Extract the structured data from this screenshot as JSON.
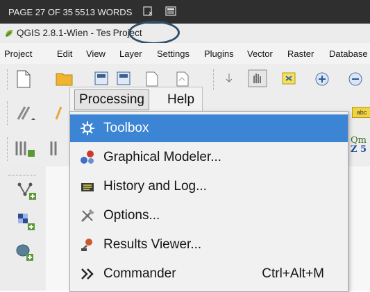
{
  "word_status": {
    "page": "PAGE 27 OF 35",
    "words": "5513 WORDS"
  },
  "window": {
    "title_prefix": "QGIS 2.8.1-Wien - Tes",
    "title_suffix": "Project"
  },
  "menubar": {
    "items": [
      "Project",
      "Edit",
      "View",
      "Layer",
      "Settings",
      "Plugins",
      "Vector",
      "Raster",
      "Database"
    ]
  },
  "toolbar_partial_text": {
    "abc": "abc",
    "qm": "Qm",
    "z5": "Z 5"
  },
  "menu": {
    "processing_label": "Processing",
    "help_label": "Help",
    "items": [
      {
        "label": "Toolbox",
        "shortcut": "",
        "icon": "gear-icon"
      },
      {
        "label": "Graphical Modeler...",
        "shortcut": "",
        "icon": "modeler-icon"
      },
      {
        "label": "History and Log...",
        "shortcut": "",
        "icon": "history-icon"
      },
      {
        "label": "Options...",
        "shortcut": "",
        "icon": "tools-icon"
      },
      {
        "label": "Results Viewer...",
        "shortcut": "",
        "icon": "results-icon"
      },
      {
        "label": "Commander",
        "shortcut": "Ctrl+Alt+M",
        "icon": "chevrons-icon"
      }
    ]
  },
  "colors": {
    "highlight": "#3c84d4",
    "annotation_circle": "#2f4e6a",
    "status_bar": "#2f2f2f"
  }
}
